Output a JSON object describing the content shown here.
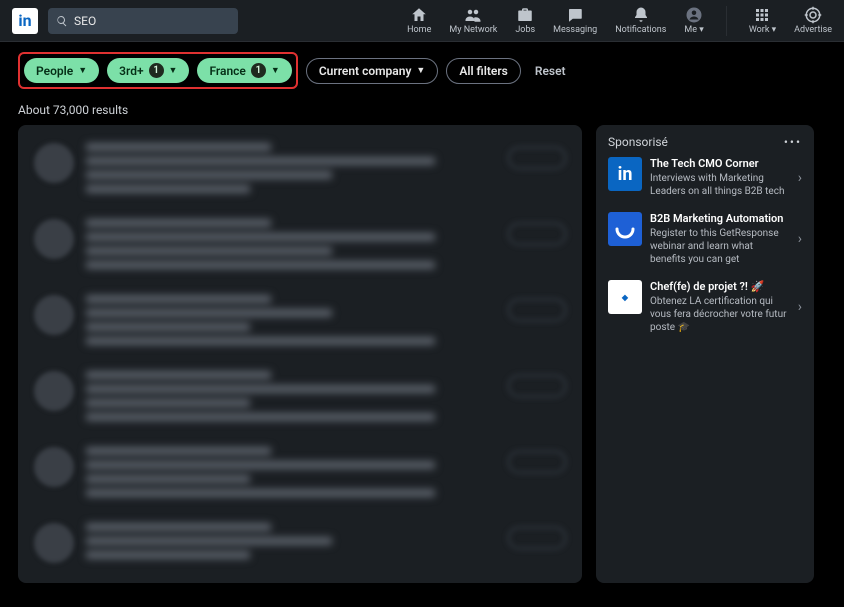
{
  "brand": {
    "logo_text": "in"
  },
  "search": {
    "query": "SEO"
  },
  "nav": {
    "home": "Home",
    "network": "My Network",
    "jobs": "Jobs",
    "messaging": "Messaging",
    "notifications": "Notifications",
    "me": "Me ▾",
    "work": "Work ▾",
    "advertise": "Advertise"
  },
  "filters": {
    "people": "People",
    "connections": "3rd+",
    "connections_count": "1",
    "location": "France",
    "location_count": "1",
    "company": "Current company",
    "all": "All filters",
    "reset": "Reset"
  },
  "results": {
    "count_text": "About 73,000 results"
  },
  "sponsored": {
    "header": "Sponsorisé",
    "items": [
      {
        "title": "The Tech CMO Corner",
        "desc": "Interviews with Marketing Leaders on all things B2B tech"
      },
      {
        "title": "B2B Marketing Automation",
        "desc": "Register to this GetResponse webinar and learn what benefits you can get"
      },
      {
        "title": "Chef(fe) de projet ?! 🚀",
        "desc": "Obtenez LA certification qui vous fera décrocher votre futur poste 🎓"
      }
    ]
  }
}
